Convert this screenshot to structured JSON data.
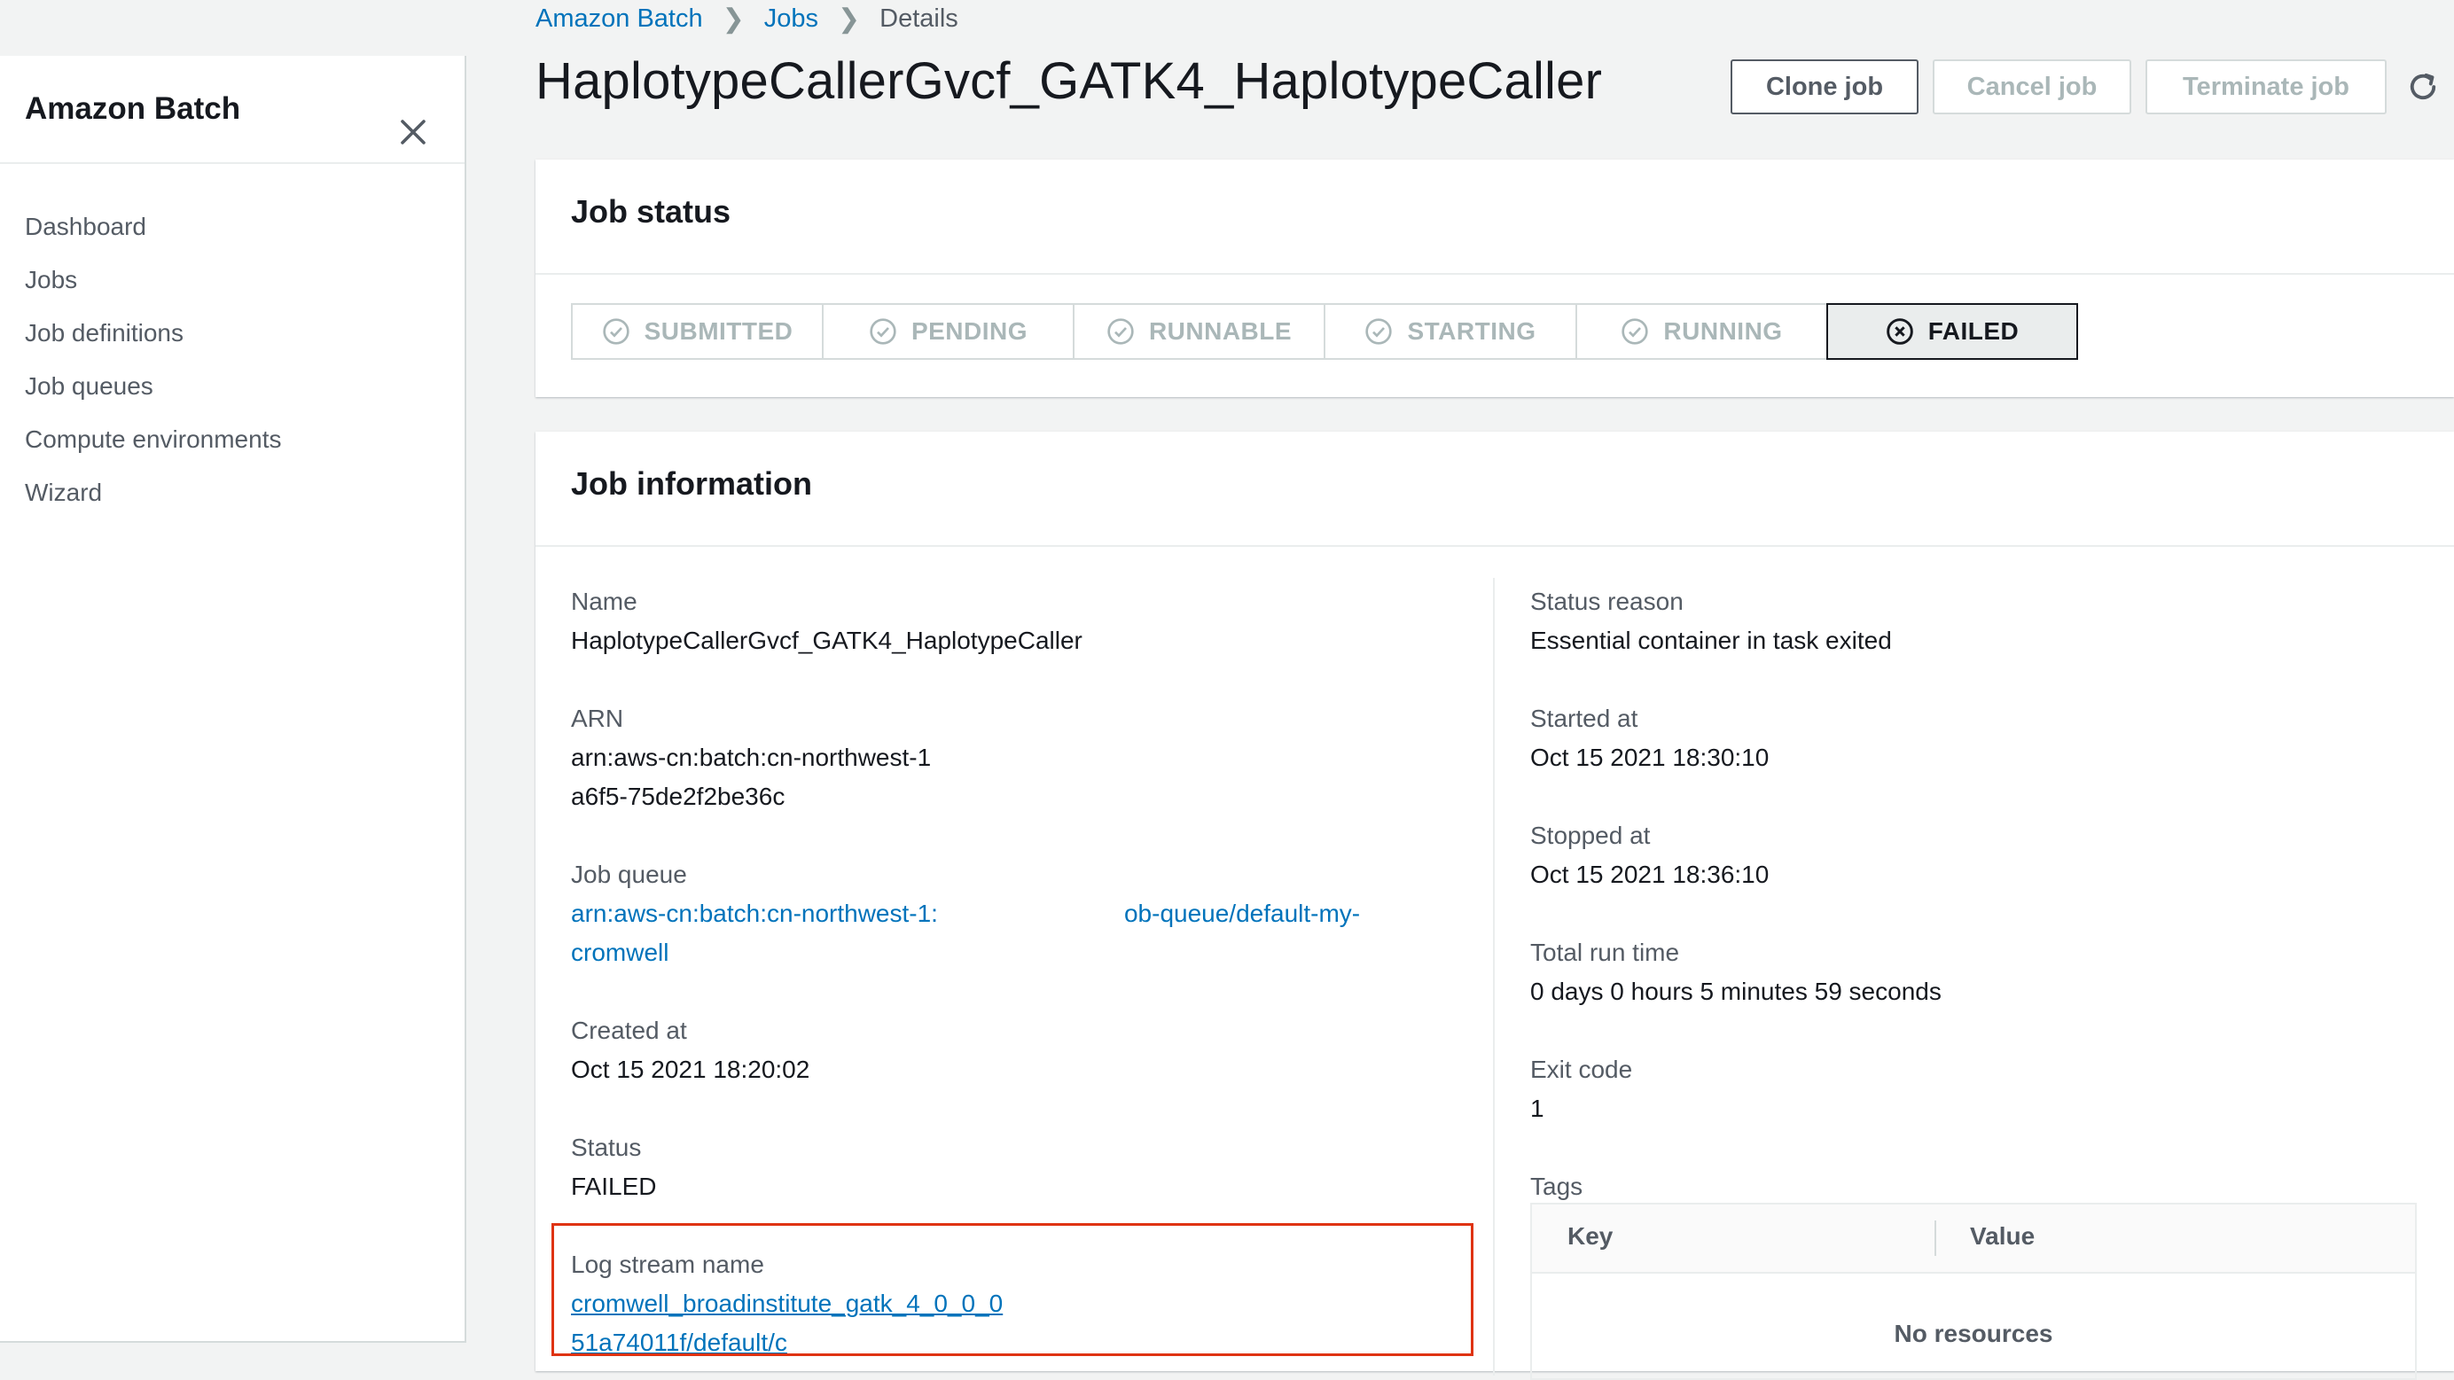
{
  "sidebar": {
    "title": "Amazon Batch",
    "items": [
      {
        "label": "Dashboard"
      },
      {
        "label": "Jobs"
      },
      {
        "label": "Job definitions"
      },
      {
        "label": "Job queues"
      },
      {
        "label": "Compute environments"
      },
      {
        "label": "Wizard"
      }
    ]
  },
  "breadcrumb": {
    "items": [
      {
        "label": "Amazon Batch"
      },
      {
        "label": "Jobs"
      },
      {
        "label": "Details"
      }
    ]
  },
  "page": {
    "title": "HaplotypeCallerGvcf_GATK4_HaplotypeCaller"
  },
  "actions": {
    "clone": "Clone job",
    "cancel": "Cancel job",
    "terminate": "Terminate job"
  },
  "job_status": {
    "heading": "Job status",
    "steps": [
      {
        "label": "SUBMITTED"
      },
      {
        "label": "PENDING"
      },
      {
        "label": "RUNNABLE"
      },
      {
        "label": "STARTING"
      },
      {
        "label": "RUNNING"
      },
      {
        "label": "FAILED"
      }
    ],
    "active_step": "FAILED"
  },
  "job_info": {
    "heading": "Job information",
    "name": {
      "label": "Name",
      "value": "HaplotypeCallerGvcf_GATK4_HaplotypeCaller"
    },
    "arn": {
      "label": "ARN",
      "line1": "arn:aws-cn:batch:cn-northwest-1",
      "line2": "a6f5-75de2f2be36c"
    },
    "job_queue": {
      "label": "Job queue",
      "line1_start": "arn:aws-cn:batch:cn-northwest-1:",
      "line1_end": "ob-queue/default-my-",
      "line2": "cromwell"
    },
    "created_at": {
      "label": "Created at",
      "value": "Oct 15 2021 18:20:02"
    },
    "status": {
      "label": "Status",
      "value": "FAILED"
    },
    "log_stream": {
      "label": "Log stream name",
      "line1": "cromwell_broadinstitute_gatk_4_0_0_0",
      "line2": "51a74011f/default/c"
    },
    "status_reason": {
      "label": "Status reason",
      "value": "Essential container in task exited"
    },
    "started_at": {
      "label": "Started at",
      "value": "Oct 15 2021 18:30:10"
    },
    "stopped_at": {
      "label": "Stopped at",
      "value": "Oct 15 2021 18:36:10"
    },
    "total_run_time": {
      "label": "Total run time",
      "value": "0 days 0 hours 5 minutes 59 seconds"
    },
    "exit_code": {
      "label": "Exit code",
      "value": "1"
    },
    "tags": {
      "label": "Tags",
      "columns": [
        "Key",
        "Value"
      ],
      "empty_text": "No resources"
    }
  },
  "colors": {
    "link": "#0073bb",
    "highlight_border": "#df3312",
    "text": "#16191f",
    "muted": "#545b64",
    "disabled": "#aab7b8"
  }
}
